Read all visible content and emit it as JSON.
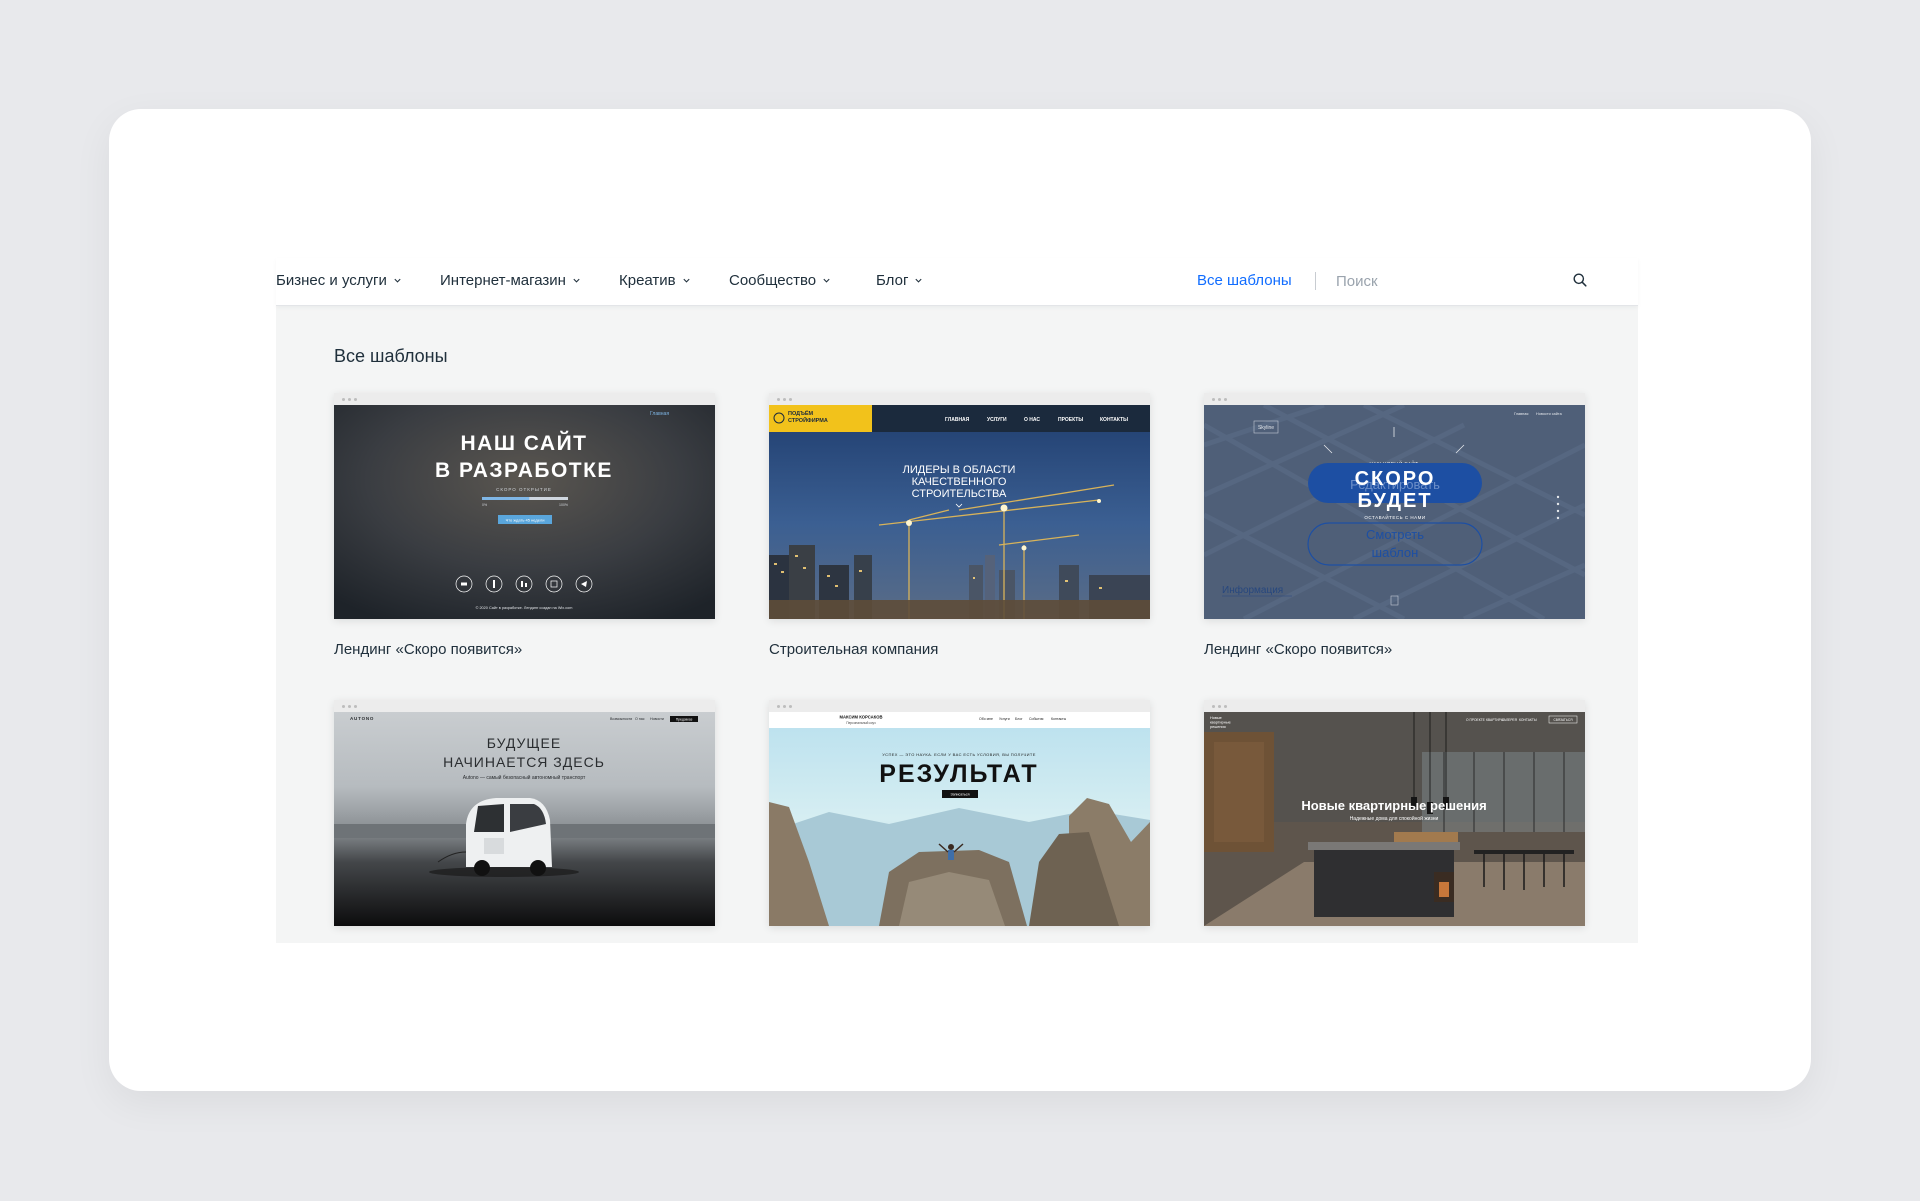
{
  "nav": {
    "items": [
      {
        "label": "Бизнес и услуги"
      },
      {
        "label": "Интернет-магазин"
      },
      {
        "label": "Креатив"
      },
      {
        "label": "Сообщество"
      },
      {
        "label": "Блог"
      }
    ],
    "all_templates": "Все шаблоны",
    "search_placeholder": "Поиск"
  },
  "main": {
    "title": "Все шаблоны",
    "templates": [
      {
        "name": "Лендинг «Скоро появится»",
        "preview": {
          "heading_1": "НАШ САЙТ",
          "heading_2": "В РАЗРАБОТКЕ",
          "subtitle": "СКОРО ОТКРЫТИЕ",
          "progress_start": "0%",
          "progress_end": "100%",
          "progress_fill": 0.55,
          "button": "Что ждать 45 недели",
          "top_link": "Главная",
          "footer": "© 2020 Сайт в разработке. Лендинг создан на Wix.com"
        }
      },
      {
        "name": "Строительная компания",
        "preview": {
          "logo_1": "ПОДЪЁМ",
          "logo_2": "СТРОЙФИРМА",
          "menu": [
            "ГЛАВНАЯ",
            "УСЛУГИ",
            "О НАС",
            "ПРОЕКТЫ",
            "КОНТАКТЫ"
          ],
          "hero_1": "ЛИДЕРЫ В ОБЛАСТИ",
          "hero_2": "КАЧЕСТВЕННОГО",
          "hero_3": "СТРОИТЕЛЬСТВА"
        }
      },
      {
        "name": "Лендинг «Скоро появится»",
        "preview": {
          "logo": "Skyline",
          "menu": [
            "Главная",
            "Новости сайта"
          ],
          "eyebrow": "НАШ НОВЫЙ САЙТ",
          "overlay_button": "Редактировать",
          "heading_1": "СКОРО",
          "heading_2": "БУДЕТ",
          "stay": "ОСТАВАЙТЕСЬ С НАМИ",
          "view_1": "Смотреть",
          "view_2": "шаблон",
          "info": "Информация"
        }
      },
      {
        "name": "",
        "preview": {
          "logo": "AUTONO",
          "menu": [
            "Возможности",
            "О нас",
            "Новости",
            "Предзаказ"
          ],
          "heading_1": "БУДУЩЕЕ",
          "heading_2": "НАЧИНАЕТСЯ ЗДЕСЬ",
          "subtitle": "Autono — самый безопасный автономный транспорт"
        }
      },
      {
        "name": "",
        "preview": {
          "name_1": "МАКСИМ КОРСАКОВ",
          "name_2": "Персональный коуч",
          "menu": [
            "Обо мне",
            "Услуги",
            "Блог",
            "События",
            "Контакты"
          ],
          "quote": "УСПЕХ — ЭТО НАУКА. ЕСЛИ У ВАС ЕСТЬ УСЛОВИЯ, ВЫ ПОЛУЧИТЕ",
          "heading": "РЕЗУЛЬТАТ",
          "button": "Записаться"
        }
      },
      {
        "name": "",
        "preview": {
          "logo_1": "Новые",
          "logo_2": "квартирные",
          "logo_3": "решения",
          "menu": [
            "О ПРОЕКТЕ",
            "КВАРТИРЫ",
            "ГАЛЕРЕЯ",
            "КОНТАКТЫ"
          ],
          "button": "СВЯЗАТЬСЯ",
          "heading": "Новые квартирные решения",
          "subtitle": "Надежные дома для спокойной жизни"
        }
      }
    ]
  }
}
